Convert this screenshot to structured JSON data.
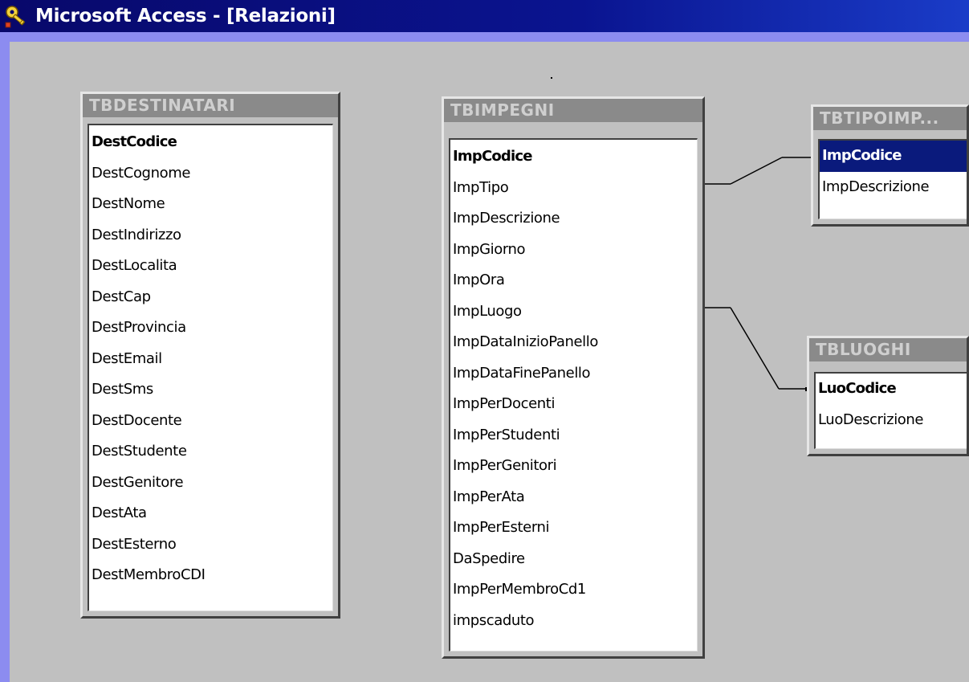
{
  "window": {
    "title": "Microsoft Access - [Relazioni]",
    "icon": "key-relationships-icon"
  },
  "colors": {
    "title_bar": "#0a1490",
    "background": "#8c8cf0",
    "workspace": "#c0c0c0",
    "selection": "#0a1a7c"
  },
  "tables": {
    "destinatari": {
      "title": "TBDESTINATARI",
      "fields": [
        "DestCodice",
        "DestCognome",
        "DestNome",
        "DestIndirizzo",
        "DestLocalita",
        "DestCap",
        "DestProvincia",
        "DestEmail",
        "DestSms",
        "DestDocente",
        "DestStudente",
        "DestGenitore",
        "DestAta",
        "DestEsterno",
        "DestMembroCDI"
      ],
      "primary_key": "DestCodice"
    },
    "impegni": {
      "title": "TBIMPEGNI",
      "fields": [
        "ImpCodice",
        "ImpTipo",
        "ImpDescrizione",
        "ImpGiorno",
        "ImpOra",
        "ImpLuogo",
        "ImpDataInizioPanello",
        "ImpDataFinePanello",
        "ImpPerDocenti",
        "ImpPerStudenti",
        "ImpPerGenitori",
        "ImpPerAta",
        "ImpPerEsterni",
        "DaSpedire",
        "ImpPerMembroCd1",
        "impscaduto"
      ],
      "primary_key": "ImpCodice"
    },
    "tipoimp": {
      "title": "TBTIPOIMP...",
      "fields": [
        "ImpCodice",
        "ImpDescrizione"
      ],
      "primary_key": "ImpCodice",
      "selected": "ImpCodice"
    },
    "luoghi": {
      "title": "TBLUOGHI",
      "fields": [
        "LuoCodice",
        "LuoDescrizione"
      ],
      "primary_key": "LuoCodice"
    }
  },
  "relationships": [
    {
      "from_table": "TBIMPEGNI",
      "from_field": "ImpTipo",
      "to_table": "TBTIPOIMP...",
      "to_field": "ImpCodice"
    },
    {
      "from_table": "TBIMPEGNI",
      "from_field": "ImpLuogo",
      "to_table": "TBLUOGHI",
      "to_field": "LuoCodice"
    }
  ]
}
